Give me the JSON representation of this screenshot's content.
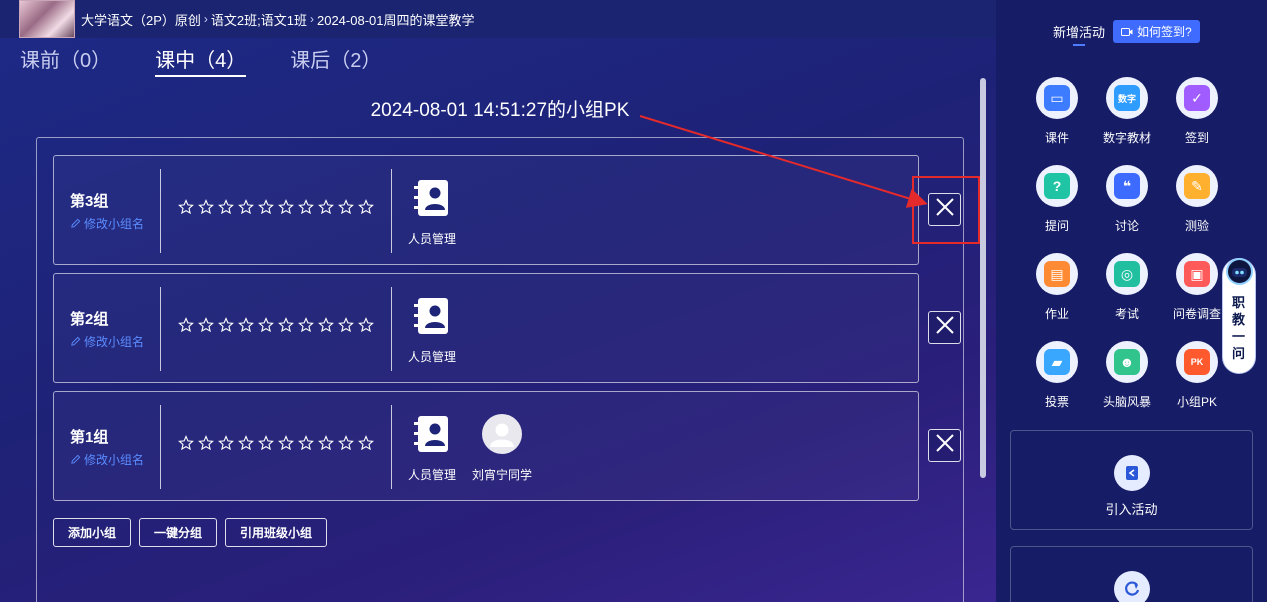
{
  "breadcrumb": {
    "course": "大学语文（2P）原创",
    "classes": "语文2班;语文1班",
    "session": "2024-08-01周四的课堂教学",
    "separator": "›"
  },
  "tabs": [
    {
      "label": "课前（0）",
      "active": false
    },
    {
      "label": "课中（4）",
      "active": true
    },
    {
      "label": "课后（2）",
      "active": false
    }
  ],
  "pk_title": "2024-08-01 14:51:27的小组PK",
  "groups": [
    {
      "name": "第3组",
      "edit_label": "修改小组名",
      "stars": 10,
      "manage_label": "人员管理",
      "members": []
    },
    {
      "name": "第2组",
      "edit_label": "修改小组名",
      "stars": 10,
      "manage_label": "人员管理",
      "members": []
    },
    {
      "name": "第1组",
      "edit_label": "修改小组名",
      "stars": 10,
      "manage_label": "人员管理",
      "members": [
        "刘宵宁同学"
      ]
    }
  ],
  "actions": {
    "add_group": "添加小组",
    "auto_group": "一键分组",
    "import_group": "引用班级小组"
  },
  "sidebar": {
    "title": "新增活动",
    "signin_help": "如何签到?",
    "activities": [
      {
        "label": "课件",
        "icon": "courseware-icon",
        "color": "#3d7bff",
        "glyph": "▭"
      },
      {
        "label": "数字教材",
        "icon": "digital-textbook-icon",
        "color": "#2f9cff",
        "glyph": "数字"
      },
      {
        "label": "签到",
        "icon": "signin-icon",
        "color": "#a05cff",
        "glyph": "✓"
      },
      {
        "label": "提问",
        "icon": "question-icon",
        "color": "#1fc4a4",
        "glyph": "?"
      },
      {
        "label": "讨论",
        "icon": "discussion-icon",
        "color": "#3d6bff",
        "glyph": "❝"
      },
      {
        "label": "测验",
        "icon": "quiz-icon",
        "color": "#ffb02e",
        "glyph": "✎"
      },
      {
        "label": "作业",
        "icon": "homework-icon",
        "color": "#ff8a34",
        "glyph": "▤"
      },
      {
        "label": "考试",
        "icon": "exam-icon",
        "color": "#1fbfa0",
        "glyph": "◎"
      },
      {
        "label": "问卷调查",
        "icon": "survey-icon",
        "color": "#ff5a5a",
        "glyph": "▣"
      },
      {
        "label": "投票",
        "icon": "vote-icon",
        "color": "#3aa7ff",
        "glyph": "▰"
      },
      {
        "label": "头脑风暴",
        "icon": "brainstorm-icon",
        "color": "#31c48d",
        "glyph": "☻"
      },
      {
        "label": "小组PK",
        "icon": "group-pk-icon",
        "color": "#ff5a2e",
        "glyph": "PK"
      }
    ],
    "import_activity": "引入活动",
    "assistant_label": "职教一问"
  },
  "colors": {
    "accent": "#3f6bff",
    "edit_link": "#5b8cff",
    "highlight": "#e42a2a"
  }
}
